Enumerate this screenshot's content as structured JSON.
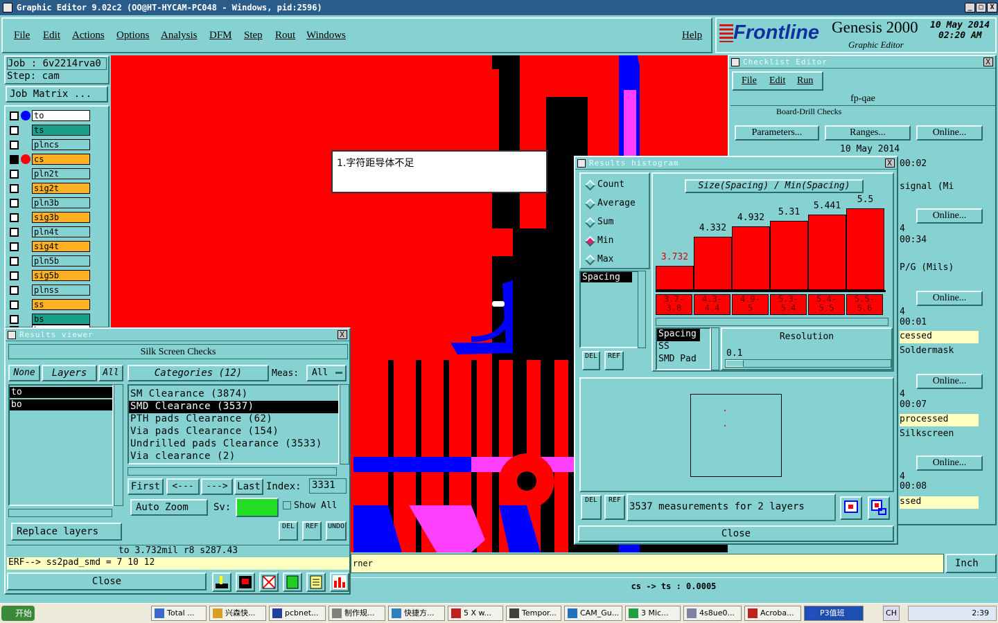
{
  "window": {
    "title": "Graphic Editor 9.02c2  (OO@HT-HYCAM-PC048 - Windows, pid:2596)",
    "min": "_",
    "max": "□",
    "close": "X"
  },
  "menu": {
    "items": [
      "File",
      "Edit",
      "Actions",
      "Options",
      "Analysis",
      "DFM",
      "Step",
      "Rout",
      "Windows"
    ],
    "help": "Help"
  },
  "brand": {
    "logo": "Frontline",
    "product": "Genesis 2000",
    "subtitle": "Graphic Editor",
    "date": "10 May 2014",
    "time": "02:20 AM"
  },
  "job": {
    "job": "Job  : 6v2214rva0",
    "step": "Step: cam",
    "matrix": "Job Matrix ..."
  },
  "layers": [
    {
      "name": "to",
      "color": "#ffffff",
      "dot": "#0000ff"
    },
    {
      "name": "ts",
      "color": "#1aa08a",
      "dot": ""
    },
    {
      "name": "plncs",
      "color": "#86d2d2",
      "dot": ""
    },
    {
      "name": "cs",
      "color": "#ffb020",
      "dot": "#ff0000"
    },
    {
      "name": "pln2t",
      "color": "#86d2d2",
      "dot": ""
    },
    {
      "name": "sig2t",
      "color": "#ffb020",
      "dot": ""
    },
    {
      "name": "pln3b",
      "color": "#86d2d2",
      "dot": ""
    },
    {
      "name": "sig3b",
      "color": "#ffb020",
      "dot": ""
    },
    {
      "name": "pln4t",
      "color": "#86d2d2",
      "dot": ""
    },
    {
      "name": "sig4t",
      "color": "#ffb020",
      "dot": ""
    },
    {
      "name": "pln5b",
      "color": "#86d2d2",
      "dot": ""
    },
    {
      "name": "sig5b",
      "color": "#ffb020",
      "dot": ""
    },
    {
      "name": "plnss",
      "color": "#86d2d2",
      "dot": ""
    },
    {
      "name": "ss",
      "color": "#ffb020",
      "dot": ""
    },
    {
      "name": "bs",
      "color": "#1aa08a",
      "dot": ""
    },
    {
      "name": "bo",
      "color": "#ffffff",
      "dot": ""
    }
  ],
  "callout": "1.字符距导体不足",
  "checklist": {
    "title": "Checklist Editor",
    "menu": [
      "File",
      "Edit",
      "Run"
    ],
    "name": "fp-qae",
    "row": "Board-Drill Checks",
    "params": "Parameters...",
    "ranges": "Ranges...",
    "online": "Online...",
    "date": "10 May 2014",
    "side": [
      "00:02",
      "signal (Mi",
      "Online...",
      "4",
      "00:34",
      "P/G (Mils)",
      "Online...",
      "4",
      "00:01",
      "cessed",
      "Soldermask",
      "Online...",
      "4",
      "00:07",
      "processed",
      "Silkscreen",
      "Online...",
      "4",
      "00:08",
      "ssed"
    ]
  },
  "histogram": {
    "title": "Results histogram",
    "modes": [
      "Count",
      "Average",
      "Sum",
      "Min",
      "Max"
    ],
    "selected_mode": "Min",
    "measure": "Spacing",
    "chart_title": "Size(Spacing) / Min(Spacing)",
    "types": [
      "Spacing",
      "SS",
      "SMD Pad"
    ],
    "resolution_label": "Resolution",
    "resolution": "0.1",
    "summary": "3537 measurements for 2 layers",
    "close": "Close",
    "del": "DEL",
    "ref": "REF"
  },
  "chart_data": {
    "type": "bar",
    "title": "Size(Spacing) / Min(Spacing)",
    "categories": [
      "3.7-3.8",
      "4.3-4.4",
      "4.9-5",
      "5.3-5.4",
      "5.4-5.5",
      "5.5-5.6"
    ],
    "values": [
      3.732,
      4.332,
      4.932,
      5.31,
      5.441,
      5.5
    ],
    "bar_heights_relative": [
      0.3,
      0.65,
      0.78,
      0.85,
      0.92,
      1.0
    ]
  },
  "results": {
    "title": "Results viewer",
    "header": "Silk Screen Checks",
    "none": "None",
    "layers": "Layers",
    "all": "All",
    "categories": "Categories (12)",
    "meas": "Meas:",
    "meas_val": "All",
    "layer_list": [
      "to",
      "bo"
    ],
    "items": [
      "SM Clearance (3874)",
      "SMD Clearance (3537)",
      "PTH pads Clearance (62)",
      "Via pads Clearance (154)",
      "Undrilled pads Clearance (3533)",
      "Via clearance (2)"
    ],
    "selected": "SMD Clearance (3537)",
    "first": "First",
    "prev": "<---",
    "next": "--->",
    "last": "Last",
    "index_label": "Index:",
    "index": "3331",
    "autozoom": "Auto Zoom",
    "sv": "Sv:",
    "showall": "Show All",
    "replace": "Replace layers",
    "del": "DEL",
    "ref": "REF",
    "undo": "UNDO",
    "status": "to 3.732mil   r8   s287.43",
    "erf": "ERF--> ss2pad_smd = 7 10 12",
    "close": "Close"
  },
  "bottom": {
    "corner": "rner",
    "units": "Inch",
    "cmd": "cs -> ts : 0.0005"
  },
  "taskbar": {
    "start": "开始",
    "tasks": [
      "Total ...",
      "兴森快...",
      "pcbnet...",
      "制作规...",
      "快捷方...",
      "5 X w...",
      "Tempor...",
      "CAM_Gu...",
      "3 Mic...",
      "4s8ue0...",
      "Acroba...",
      "P3值班"
    ],
    "lang": "CH",
    "clock": "2:39"
  }
}
